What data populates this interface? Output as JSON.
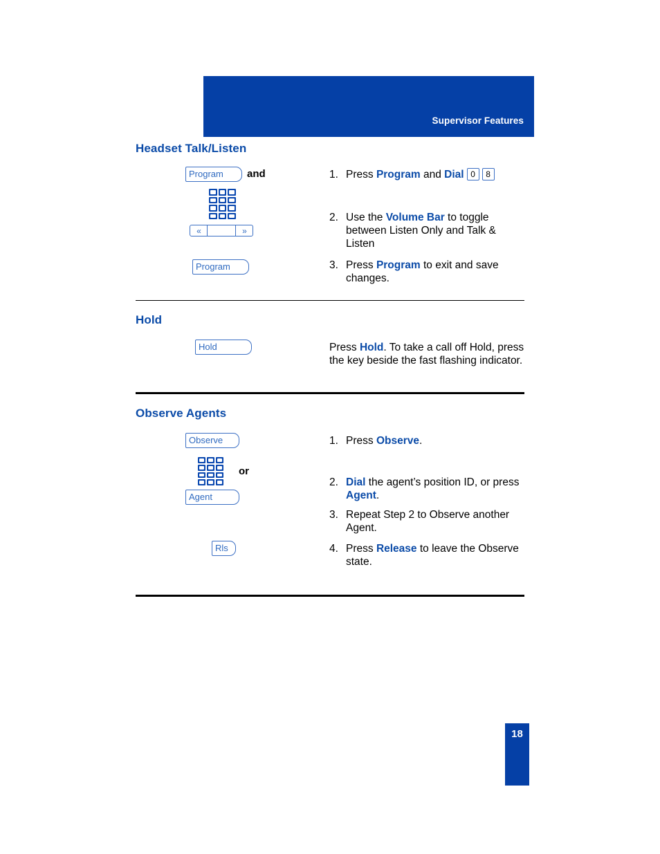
{
  "header": {
    "title": "Supervisor Features"
  },
  "sections": [
    {
      "id": "headset-talk-listen",
      "title": "Headset Talk/Listen",
      "icons": {
        "program_key": "Program",
        "and_label": "and",
        "keypad": "keypad-icon",
        "volume_bar": "volume-bar-icon",
        "volume_left": "«",
        "volume_right": "»",
        "program_key_2": "Program"
      },
      "steps": [
        {
          "num": "1.",
          "parts": [
            {
              "t": "Press ",
              "bold": false
            },
            {
              "t": "Program",
              "bold": true
            },
            {
              "t": " and ",
              "bold": false
            },
            {
              "t": "Dial",
              "bold": true
            }
          ],
          "digits": [
            "0",
            "8"
          ]
        },
        {
          "num": "2.",
          "parts": [
            {
              "t": "Use the ",
              "bold": false
            },
            {
              "t": "Volume Bar",
              "bold": true
            },
            {
              "t": " to toggle between Listen Only and Talk & Listen",
              "bold": false
            }
          ],
          "digits": []
        },
        {
          "num": "3.",
          "parts": [
            {
              "t": "Press ",
              "bold": false
            },
            {
              "t": "Program",
              "bold": true
            },
            {
              "t": " to exit and save changes.",
              "bold": false
            }
          ],
          "digits": []
        }
      ]
    },
    {
      "id": "hold",
      "title": "Hold",
      "icons": {
        "hold_key": "Hold"
      },
      "body": [
        {
          "t": "Press ",
          "bold": false
        },
        {
          "t": "Hold",
          "bold": true
        },
        {
          "t": ". To take a call  off Hold, press the key beside the fast flashing indicator.",
          "bold": false
        }
      ]
    },
    {
      "id": "observe-agents",
      "title": "Observe Agents",
      "icons": {
        "observe_key": "Observe",
        "keypad": "keypad-icon",
        "or_label": "or",
        "agent_key": "Agent",
        "release_key": "Rls"
      },
      "steps": [
        {
          "num": "1.",
          "parts": [
            {
              "t": "Press ",
              "bold": false
            },
            {
              "t": "Observe",
              "bold": true
            },
            {
              "t": ".",
              "bold": false
            }
          ]
        },
        {
          "num": "2.",
          "parts": [
            {
              "t": "Dial",
              "bold": true
            },
            {
              "t": " the agent’s position ID, or press ",
              "bold": false
            },
            {
              "t": "Agent",
              "bold": true
            },
            {
              "t": ".",
              "bold": false
            }
          ]
        },
        {
          "num": "3.",
          "parts": [
            {
              "t": "Repeat Step 2 to Observe another Agent.",
              "bold": false
            }
          ]
        },
        {
          "num": "4.",
          "parts": [
            {
              "t": "Press ",
              "bold": false
            },
            {
              "t": "Release",
              "bold": true
            },
            {
              "t": " to leave the Observe state.",
              "bold": false
            }
          ]
        }
      ]
    }
  ],
  "footer": {
    "page_number": "18"
  },
  "colors": {
    "brand_blue": "#0540a6",
    "heading_blue": "#0b4ba8",
    "key_border": "#3b6fc4"
  }
}
